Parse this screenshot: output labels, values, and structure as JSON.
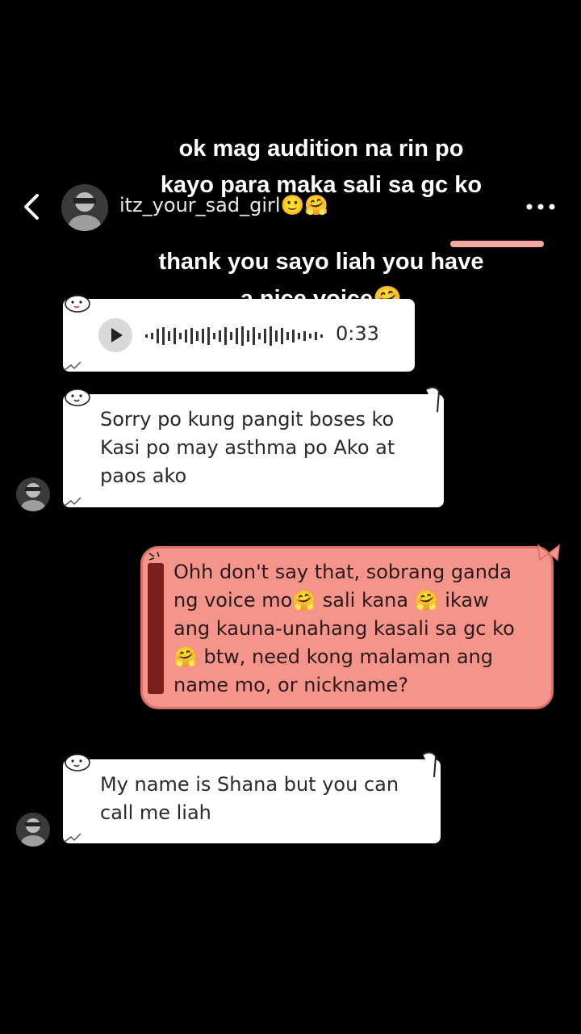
{
  "header": {
    "username": "itz_your_sad_girl🙂🤗",
    "back_icon": "chevron-left-icon",
    "more_icon": "ellipsis-icon"
  },
  "overlay_captions": {
    "line1": "ok mag audition na rin po",
    "line2": "kayo para maka sali sa gc ko",
    "line3": "thank you sayo liah you have",
    "line4": "a nice voice🤗"
  },
  "messages": [
    {
      "type": "voice",
      "direction": "incoming",
      "duration": "0:33"
    },
    {
      "type": "text",
      "direction": "incoming",
      "lines": [
        "Sorry po kung pangit boses ko",
        "Kasi po may asthma po Ako at",
        "paos ako"
      ]
    },
    {
      "type": "text",
      "direction": "outgoing",
      "lines": [
        "Ohh don't say that, sobrang ganda",
        "ng voice mo🤗 sali kana 🤗 ikaw",
        "ang kauna-unahang kasali sa gc ko",
        "🤗 btw, need kong malaman ang",
        "name mo, or nickname?"
      ]
    },
    {
      "type": "text",
      "direction": "incoming",
      "lines": [
        "My name is Shana but you can",
        "call me liah"
      ]
    }
  ],
  "colors": {
    "background": "#000000",
    "incoming_bubble": "#ffffff",
    "outgoing_bubble": "#f4948a",
    "outgoing_border": "#d9706a",
    "spine": "#7a1e1e"
  }
}
